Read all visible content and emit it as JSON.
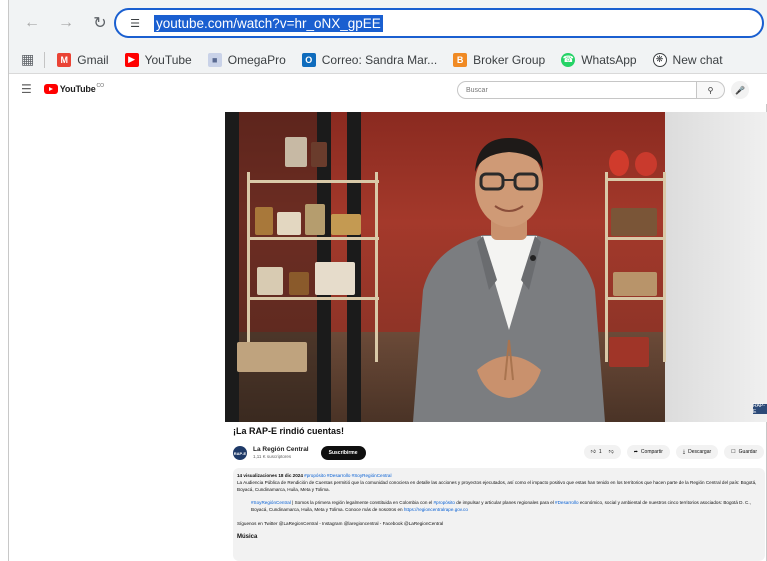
{
  "browser": {
    "url": "youtube.com/watch?v=hr_oNX_gpEE",
    "bookmarks": [
      {
        "label": "Gmail",
        "icon": "gmail-icon",
        "color": "#ea4335"
      },
      {
        "label": "YouTube",
        "icon": "youtube-icon",
        "color": "#ff0000"
      },
      {
        "label": "OmegaPro",
        "icon": "omegapro-icon",
        "color": "#9aa7c7"
      },
      {
        "label": "Correo: Sandra Mar...",
        "icon": "outlook-icon",
        "color": "#0f6cbd"
      },
      {
        "label": "Broker Group",
        "icon": "broker-group-icon",
        "color": "#f08a24"
      },
      {
        "label": "WhatsApp",
        "icon": "whatsapp-icon",
        "color": "#25d366"
      },
      {
        "label": "New chat",
        "icon": "openai-icon",
        "color": "#3c4043"
      }
    ]
  },
  "youtube": {
    "logo_text": "YouTube",
    "country_code": "CO",
    "search_placeholder": "Buscar"
  },
  "video": {
    "title": "¡La RAP-E rindió cuentas!",
    "watermark": "RAP-E",
    "channel": {
      "name": "La Región Central",
      "subscribers": "1,11 K suscriptores",
      "avatar_text": "RAP-E"
    },
    "subscribe_label": "Suscribirme",
    "likes": "1",
    "share_label": "Compartir",
    "download_label": "Descargar",
    "save_label": "Guardar",
    "description": {
      "meta": "14 visualizaciones  18 dic 2024",
      "meta_tags": "#propósito #Desarrollo #SoyRegiónCentral",
      "para1": "La Audiencia Pública de Rendición de Cuentas permitió que la comunidad conociera en detalle las acciones y proyectos ejecutados, así como el impacto positivo que estas han tenido en los territorios que hacen parte de la Región Central del país: Bogotá, Boyacá, Cundinamarca, Huila, Meta y Tolima.",
      "para2_tag": "#SoyRegiónCentral",
      "para2_a": " | Somos la primera región legalmente constituida en Colombia con el ",
      "para2_tag2": "#propósito",
      "para2_b": " de impulsar y articular planes regionales para el ",
      "para2_tag3": "#Desarrollo",
      "para2_c": " económico, social y ambiental de nuestros cinco territorios asociados: Bogotá D. C., Boyacá, Cundinamarca, Huila, Meta y Tolima. Conoce más de nosotros en ",
      "para2_link": "https://regioncentralrape.gov.co",
      "para3": "Síguenos en Twitter @LaRegionCentral - Instagram @laregioncentral - Facebook @LaRegionCentral",
      "more_heading": "Música"
    }
  }
}
